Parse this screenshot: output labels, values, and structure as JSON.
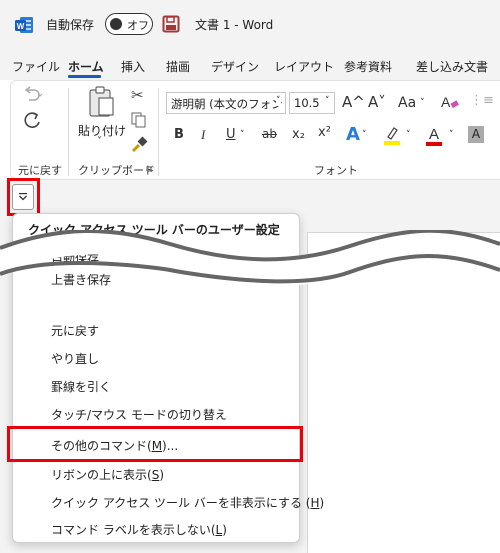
{
  "titlebar": {
    "autosave_label": "自動保存",
    "autosave_state": "オフ",
    "document_title": "文書 1  -  Word",
    "word_brand_color": "#185abd",
    "save_icon_color": "#a4373a"
  },
  "tabs": [
    {
      "label": "ファイル"
    },
    {
      "label": "ホーム",
      "active": true
    },
    {
      "label": "挿入"
    },
    {
      "label": "描画"
    },
    {
      "label": "デザイン"
    },
    {
      "label": "レイアウト"
    },
    {
      "label": "参考資料"
    },
    {
      "label": "差し込み文書"
    }
  ],
  "ribbon": {
    "undo_group_label": "元に戻す",
    "clipboard_group_label": "クリップボード",
    "paste_label": "貼り付け",
    "font_group_label": "フォント",
    "font_name": "游明朝 (本文のフォン",
    "font_size": "10.5",
    "font_grow": "A^",
    "font_shrink": "A˅",
    "change_case": "Aa",
    "bold": "B",
    "italic": "I",
    "underline": "U",
    "strikethrough": "ab",
    "subscript": "x₂",
    "superscript": "x²",
    "text_effects": "A",
    "font_color": "A",
    "shading": "A"
  },
  "menu": {
    "title": "クイック アクセス ツール バーのユーザー設定",
    "items": [
      {
        "label": "自動保存"
      },
      {
        "label": "上書き保存"
      },
      {
        "label": "元に戻す"
      },
      {
        "label": "やり直し"
      },
      {
        "label": "罫線を引く"
      },
      {
        "label": "タッチ/マウス モードの切り替え"
      },
      {
        "prefix": "その他のコマンド(",
        "key": "M",
        "suffix": ")..."
      },
      {
        "prefix": "リボンの上に表示(",
        "key": "S",
        "suffix": ")"
      },
      {
        "prefix": "クイック アクセス ツール バーを非表示にする (",
        "key": "H",
        "suffix": ")"
      },
      {
        "prefix": "コマンド ラベルを表示しない(",
        "key": "L",
        "suffix": ")"
      }
    ]
  },
  "colors": {
    "highlight_red": "#e8000b",
    "accent_blue": "#185abd",
    "text_highlight_yellow": "#ffeb00",
    "font_color_red": "#e00000"
  }
}
